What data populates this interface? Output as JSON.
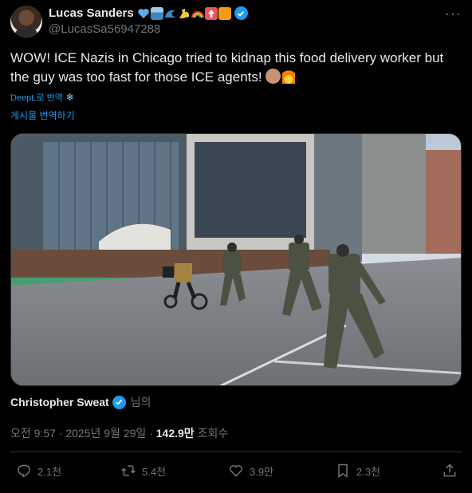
{
  "author": {
    "name": "Lucas Sanders",
    "handle": "@LucasSa56947288",
    "emoji_icons": [
      "blue-heart-icon",
      "toolbox-icon",
      "wave-icon",
      "flexed-arm-icon",
      "rainbow-icon",
      "up-arrow-icon",
      "orange-square-icon"
    ],
    "verified": true
  },
  "tweet": {
    "text": "WOW! ICE Nazis in Chicago tried to kidnap this food delivery worker but the guy was too fast for those ICE agents!",
    "trailing_icons": [
      "clapping-hands-icon",
      "fire-icon"
    ]
  },
  "translation": {
    "provider_label": "DeepL로 번역",
    "show_translation_label": "게시물 번역하기"
  },
  "credit": {
    "name": "Christopher Sweat",
    "suffix": "님의"
  },
  "meta": {
    "time": "오전 9:57",
    "separator": "·",
    "date": "2025년 9월 29일",
    "views_count": "142.9만",
    "views_label": "조회수"
  },
  "actions": {
    "replies": "2.1천",
    "reposts": "5.4천",
    "likes": "3.9만",
    "bookmarks": "2.3천"
  },
  "colors": {
    "background": "#000000",
    "text_primary": "#e7e9ea",
    "text_secondary": "#71767b",
    "accent": "#1d9bf0",
    "divider": "#2f3336"
  }
}
